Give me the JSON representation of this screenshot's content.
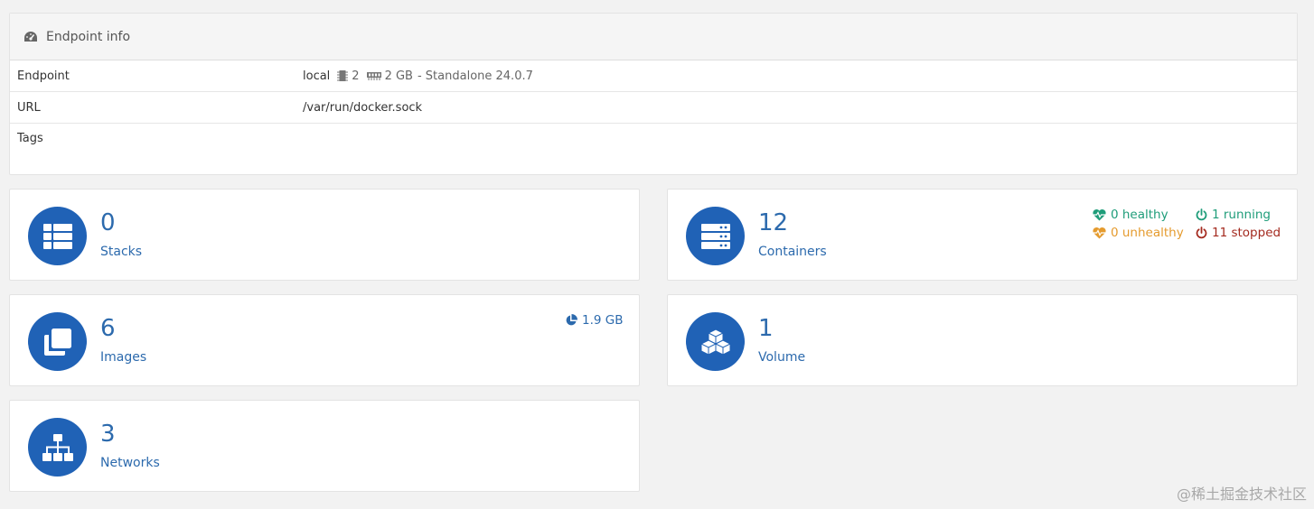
{
  "endpoint_info": {
    "title": "Endpoint info",
    "rows": {
      "endpoint": {
        "key": "Endpoint",
        "name": "local",
        "cpu": "2",
        "memory": "2 GB",
        "detail": "- Standalone 24.0.7"
      },
      "url": {
        "key": "URL",
        "value": "/var/run/docker.sock"
      },
      "tags": {
        "key": "Tags",
        "value": ""
      }
    }
  },
  "cards": {
    "stacks": {
      "count": "0",
      "label": "Stacks",
      "icon": "th-list-icon"
    },
    "containers": {
      "count": "12",
      "label": "Containers",
      "icon": "server-icon",
      "healthy": "0 healthy",
      "unhealthy": "0 unhealthy",
      "running": "1 running",
      "stopped": "11 stopped"
    },
    "images": {
      "count": "6",
      "label": "Images",
      "icon": "clone-icon",
      "size": "1.9 GB"
    },
    "volumes": {
      "count": "1",
      "label": "Volume",
      "icon": "cubes-icon"
    },
    "networks": {
      "count": "3",
      "label": "Networks",
      "icon": "sitemap-icon"
    }
  },
  "colors": {
    "accent": "#2062b6",
    "healthy": "#1f9d7a",
    "unhealthy": "#e59b2e",
    "running": "#1f9d7a",
    "stopped": "#a42a1f"
  },
  "watermark": "@稀土掘金技术社区"
}
